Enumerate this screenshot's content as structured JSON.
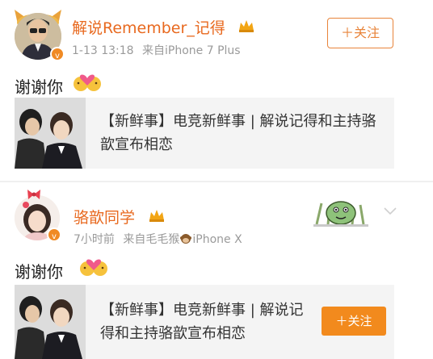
{
  "post1": {
    "username": "解说Remember_记得",
    "time": "1-13 13:18",
    "source": "来自iPhone 7 Plus",
    "text": "谢谢你",
    "follow_label": "＋关注",
    "card_text": "【新鲜事】电竞新鲜事 | 解说记得和主持骆歆宣布相恋"
  },
  "post2": {
    "username": "骆歆同学",
    "time": "7小时前",
    "source_prefix": "来自毛毛猴",
    "source_suffix": "iPhone X",
    "text": "谢谢你",
    "card_text": "【新鲜事】电竞新鲜事 | 解说记得和主持骆歆宣布相恋",
    "follow_label": "＋关注"
  },
  "colors": {
    "brand_orange": "#f28a1d",
    "name_orange": "#e8691f",
    "meta_gray": "#9a9a9a",
    "card_bg": "#f4f4f4"
  },
  "icons": [
    "verified-badge-icon",
    "member-crown-icon",
    "kiss-emoji-icon",
    "monkey-icon",
    "chevron-down-icon"
  ]
}
